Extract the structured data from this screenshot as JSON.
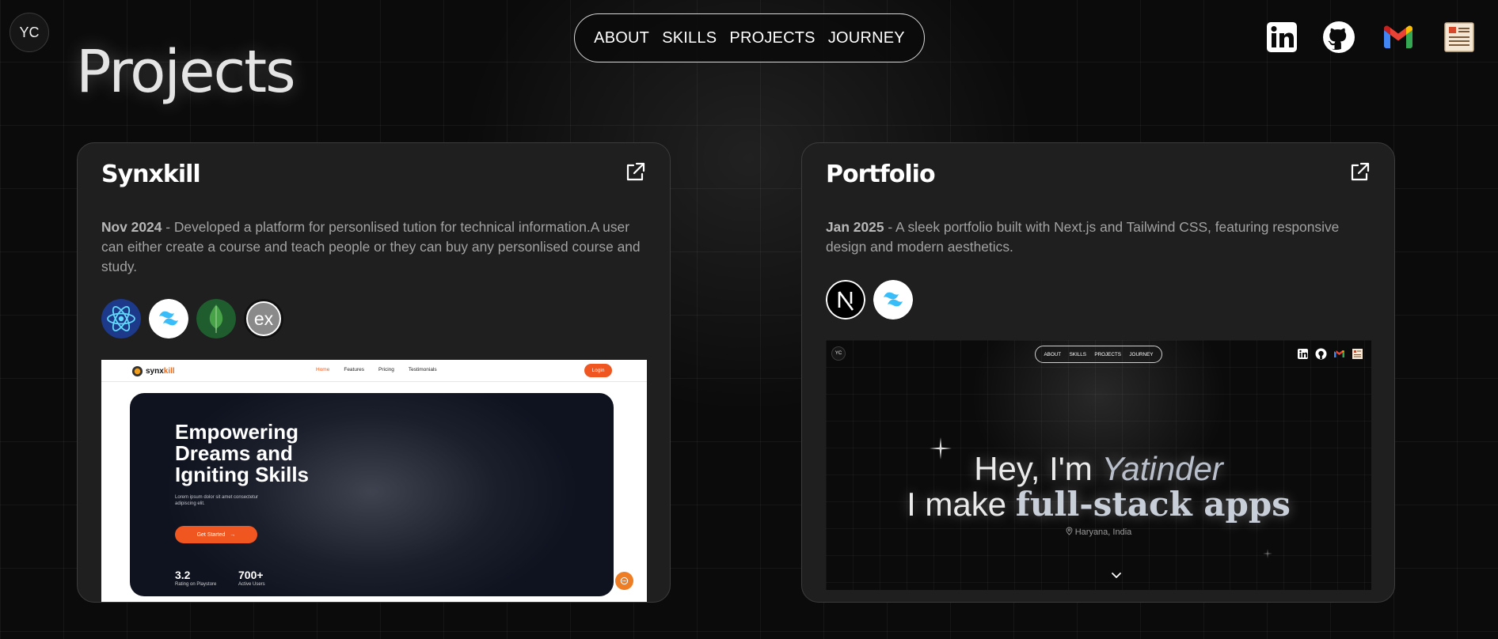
{
  "header": {
    "logo_text": "YC",
    "nav": [
      "ABOUT",
      "SKILLS",
      "PROJECTS",
      "JOURNEY"
    ],
    "social_icons": [
      "linkedin-icon",
      "github-icon",
      "gmail-icon",
      "resume-icon"
    ]
  },
  "page": {
    "title": "Projects"
  },
  "projects": [
    {
      "title": "Synxkill",
      "date": "Nov 2024",
      "separator": " - ",
      "description": "Developed a platform for personlised tution for technical information.A user can either create a course and teach people or they can buy any personlised course and study.",
      "tech_icons": [
        "react-icon",
        "tailwind-icon",
        "mongodb-icon",
        "express-icon"
      ],
      "preview": {
        "logo_part1": "synx",
        "logo_part2": "kill",
        "nav": [
          "Home",
          "Features",
          "Pricing",
          "Testimonials"
        ],
        "login": "Login",
        "hero_title": "Empowering Dreams and Igniting Skills",
        "hero_sub": "Lorem ipsum dolor sit amet consectetur adipiscing elit.",
        "cta": "Get Started",
        "cta_arrow": "→",
        "stats": [
          {
            "value": "3.2",
            "label": "Rating on Playstore"
          },
          {
            "value": "700+",
            "label": "Active Users"
          }
        ]
      }
    },
    {
      "title": "Portfolio",
      "date": "Jan 2025",
      "separator": " - ",
      "description": "A sleek portfolio built with Next.js and Tailwind CSS, featuring responsive design and modern aesthetics.",
      "tech_icons": [
        "nextjs-icon",
        "tailwind-icon"
      ],
      "preview": {
        "logo_text": "YC",
        "nav": [
          "ABOUT",
          "SKILLS",
          "PROJECTS",
          "JOURNEY"
        ],
        "hey": "Hey, I'm ",
        "name": "Yatinder",
        "make": "I make ",
        "apps": "full-stack apps",
        "location": "Haryana, India"
      }
    }
  ],
  "colors": {
    "background": "#0b0b0b",
    "card": "#1f1f1f",
    "accent_orange": "#f0561f",
    "tailwind_cyan": "#38bdf8",
    "react_blue": "#61dafb",
    "mongo_green": "#47a248"
  }
}
